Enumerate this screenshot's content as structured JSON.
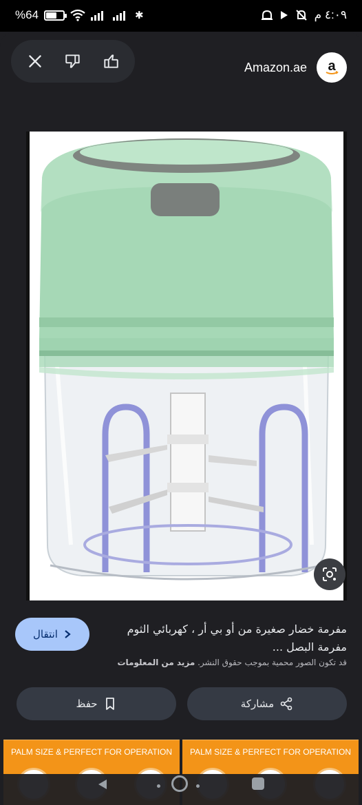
{
  "status_bar": {
    "battery_label": "%64",
    "battery_level": 0.64,
    "bluetooth_glyph": "✱",
    "time": "٤:٠٩ م",
    "right_icons": [
      "nfc-icon",
      "play-icon",
      "alarm-off-icon"
    ]
  },
  "top_actions": {
    "close_icon": "close-icon",
    "dislike_icon": "thumbs-down-icon",
    "like_icon": "thumbs-up-icon"
  },
  "source": {
    "name": "Amazon.ae",
    "logo_letter": "a"
  },
  "result": {
    "visit_label": "انتقال",
    "title": "مفرمة خضار صغيرة من أو بي أر ، كهربائي الثوم مفرمة البصل ...",
    "copyright_notice": "قد تكون الصور محمية بموجب حقوق النشر.",
    "more_info_label": "مزيد من المعلومات",
    "save_label": "حفظ",
    "share_label": "مشاركة"
  },
  "related": [
    {
      "caption": "PALM SIZE & PERFECT FOR OPERATION"
    },
    {
      "caption": "PALM SIZE & PERFECT FOR OPERATION"
    }
  ],
  "colors": {
    "sheet_bg": "#1f1f23",
    "visit_button": "#a8c7fa",
    "pill_button": "#353a44",
    "chopper_green": "#9fd3b0",
    "thumb_orange": "#f39418"
  }
}
